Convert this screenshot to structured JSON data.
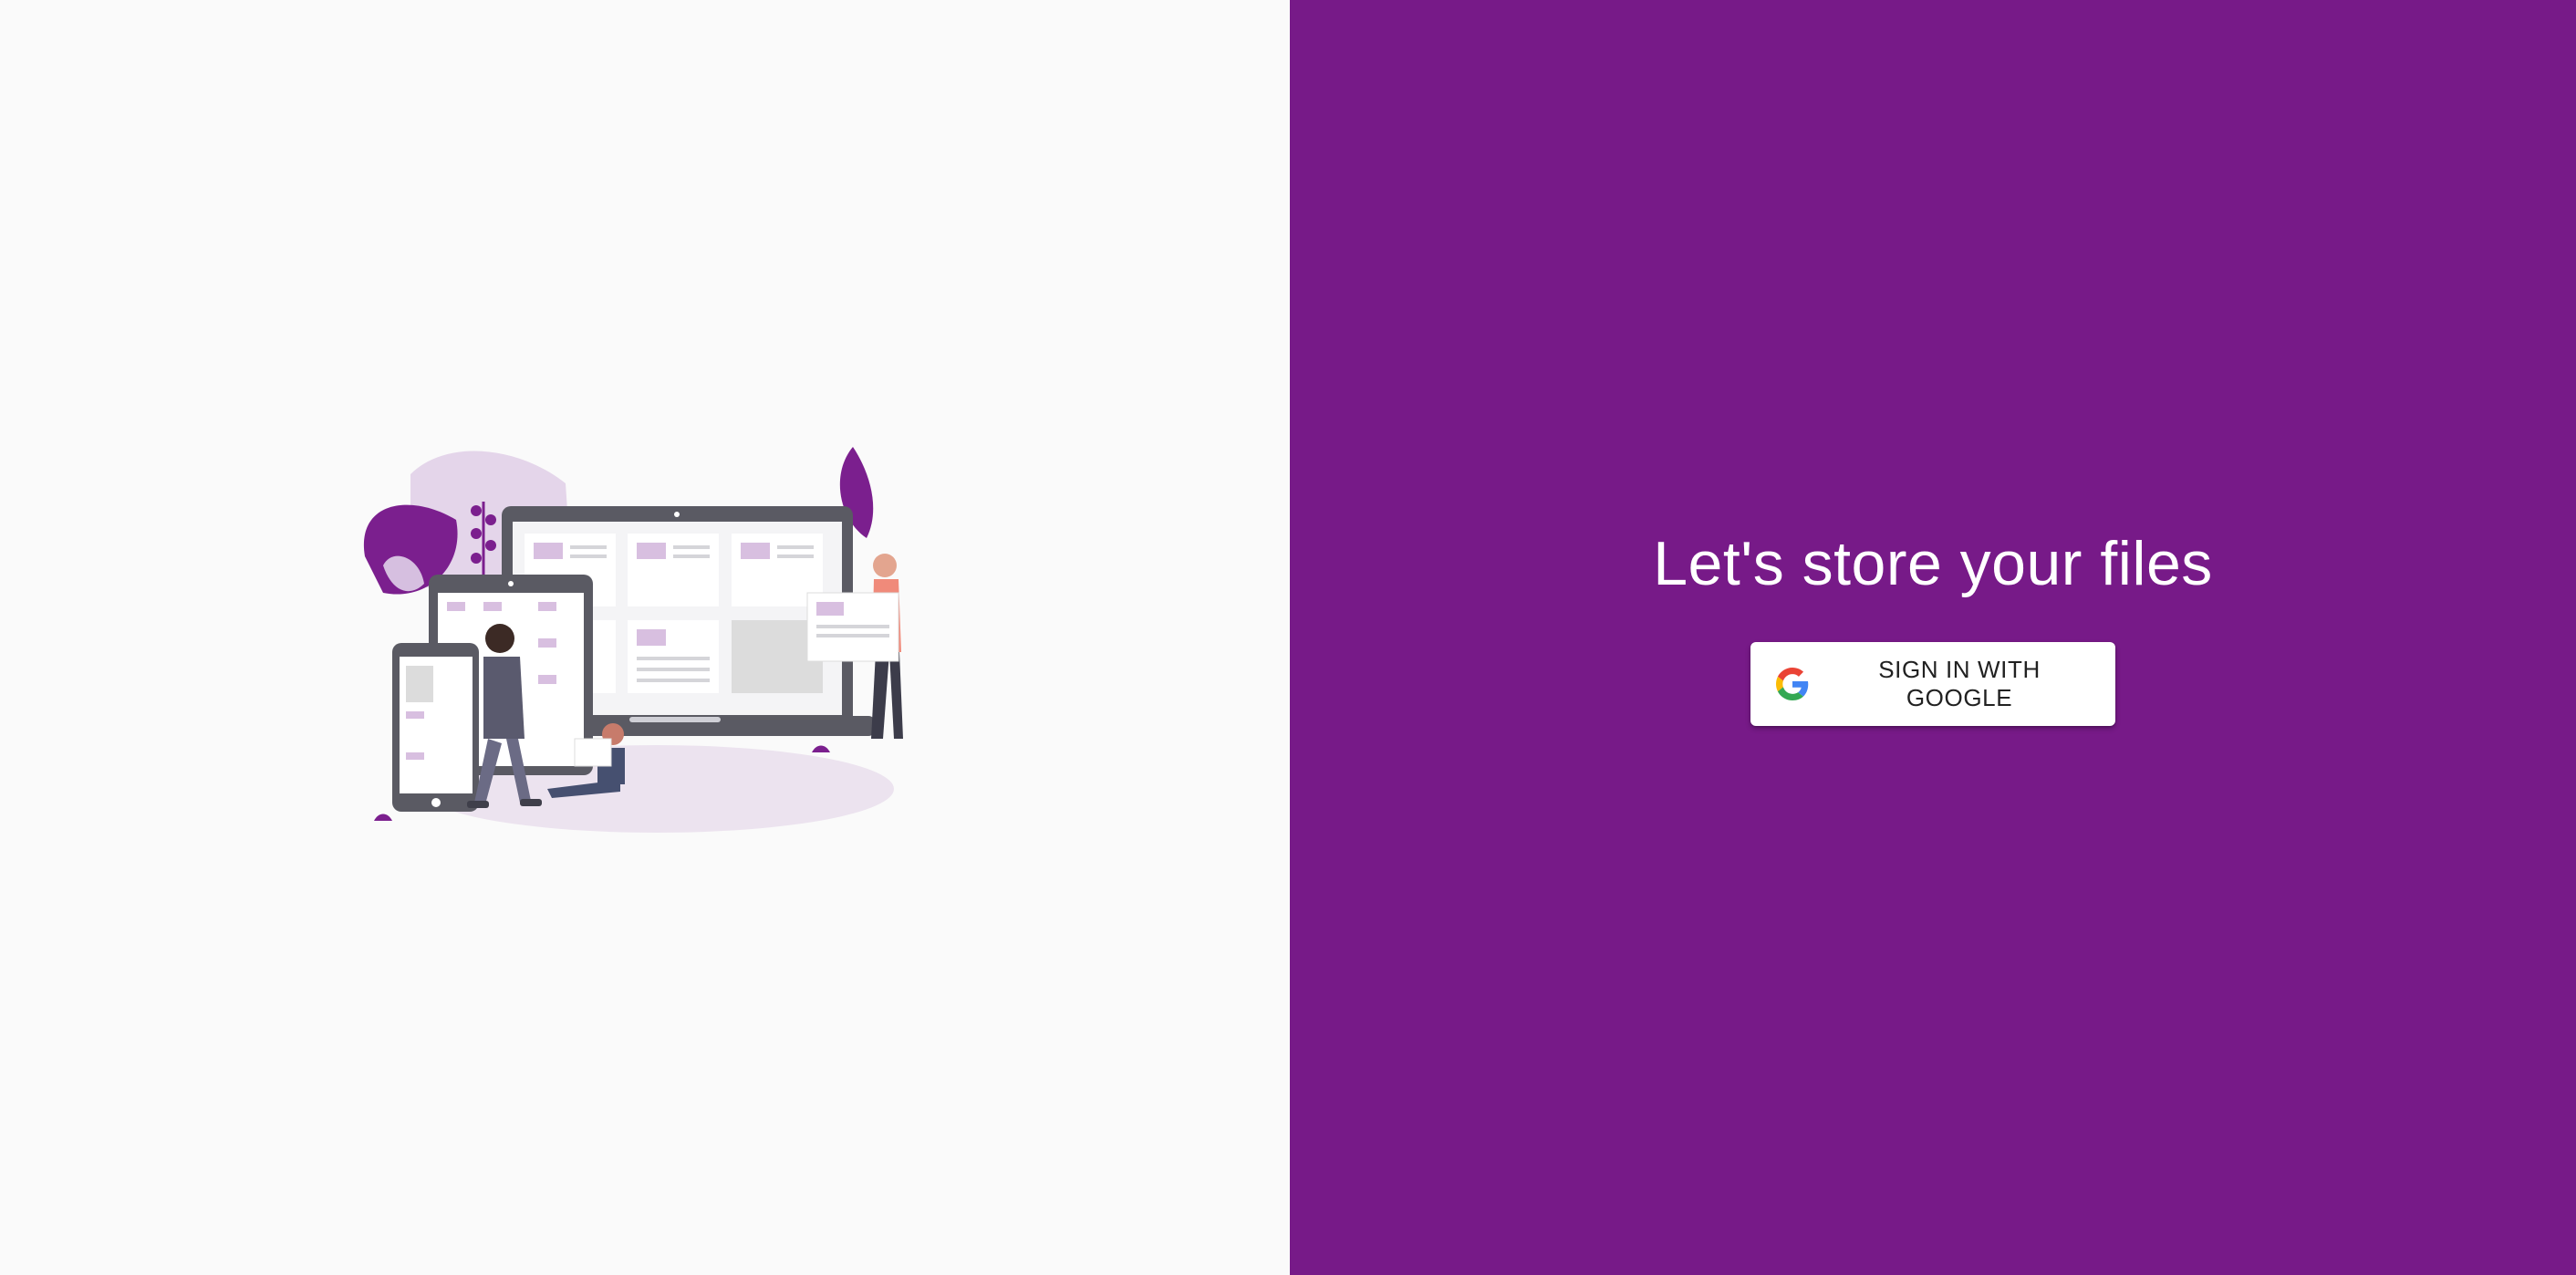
{
  "colors": {
    "left_background": "#fafafa",
    "accent_purple": "#771a88",
    "button_background": "#ffffff",
    "button_text": "#212121",
    "illustration_light_purple": "#e4d5ea",
    "illustration_dark_purple": "#6b1b7e",
    "device_gray": "#5a5a63"
  },
  "illustration": {
    "icon": "people-devices-illustration"
  },
  "auth": {
    "headline": "Let's store your files",
    "signin_button_label": "SIGN IN WITH GOOGLE",
    "signin_icon": "google-logo-icon"
  }
}
